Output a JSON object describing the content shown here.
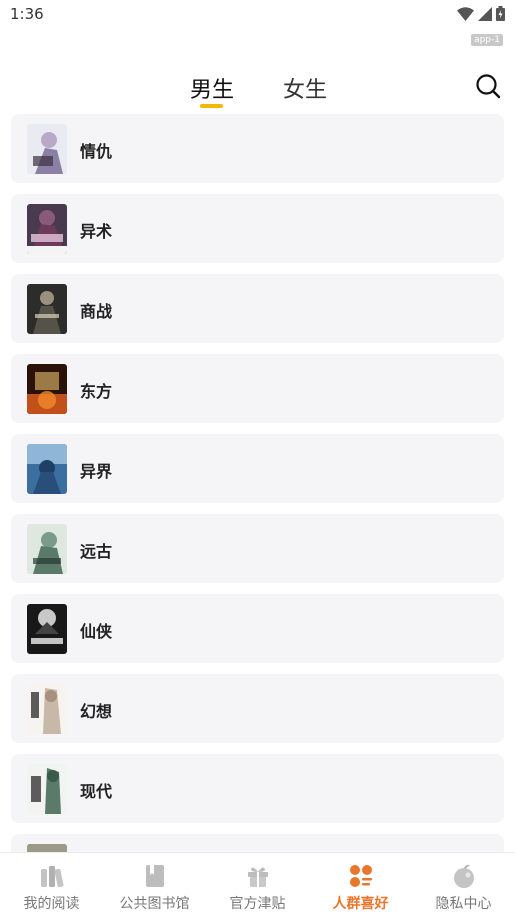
{
  "status_bar": {
    "time": "1:36",
    "app_badge": "app-1"
  },
  "top_nav": {
    "tabs": [
      {
        "label": "男生",
        "active": true
      },
      {
        "label": "女生",
        "active": false
      }
    ],
    "accent": "#f5b800"
  },
  "categories": [
    {
      "label": "情仇"
    },
    {
      "label": "异术"
    },
    {
      "label": "商战"
    },
    {
      "label": "东方"
    },
    {
      "label": "异界"
    },
    {
      "label": "远古"
    },
    {
      "label": "仙侠"
    },
    {
      "label": "幻想"
    },
    {
      "label": "现代"
    },
    {
      "label": ""
    }
  ],
  "bottom_nav": {
    "items": [
      {
        "label": "我的阅读",
        "icon": "books-icon",
        "active": false
      },
      {
        "label": "公共图书馆",
        "icon": "library-icon",
        "active": false
      },
      {
        "label": "官方津贴",
        "icon": "gift-icon",
        "active": false
      },
      {
        "label": "人群喜好",
        "icon": "preferences-icon",
        "active": true
      },
      {
        "label": "隐私中心",
        "icon": "privacy-icon",
        "active": false
      }
    ],
    "active_color": "#e8762c",
    "inactive_color": "#777777"
  }
}
